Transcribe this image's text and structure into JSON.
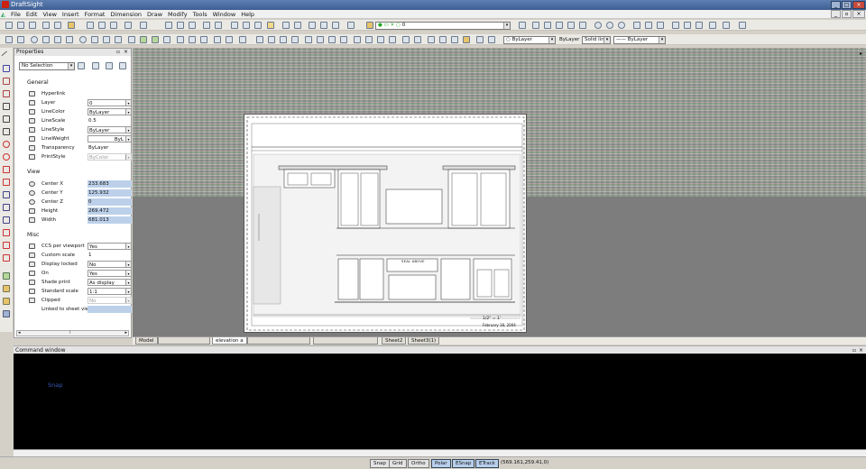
{
  "window": {
    "title": "DraftSight"
  },
  "menu": [
    "File",
    "Edit",
    "View",
    "Insert",
    "Format",
    "Dimension",
    "Draw",
    "Modify",
    "Tools",
    "Window",
    "Help"
  ],
  "toolbar": {
    "layer_combo": "0",
    "color_combo": "ByLayer",
    "linestyle_label": "ByLayer",
    "linestyle_combo": "Solid line",
    "lineweight_combo": "ByLayer"
  },
  "properties": {
    "title": "Properties",
    "selection": "No Selection",
    "general_title": "General",
    "general": [
      {
        "label": "Hyperlink",
        "value": "",
        "style": "plain"
      },
      {
        "label": "Layer",
        "value": "0",
        "style": "box"
      },
      {
        "label": "LineColor",
        "value": "ByLayer",
        "style": "box"
      },
      {
        "label": "LineScale",
        "value": "0.5",
        "style": "plain"
      },
      {
        "label": "LineStyle",
        "value": "ByLayer",
        "style": "box"
      },
      {
        "label": "LineWeight",
        "value": "ByL",
        "style": "box"
      },
      {
        "label": "Transparency",
        "value": "ByLayer",
        "style": "plain"
      },
      {
        "label": "PrintStyle",
        "value": "ByColor",
        "style": "gray"
      }
    ],
    "view_title": "View",
    "view": [
      {
        "label": "Center X",
        "value": "233.683",
        "style": "blue"
      },
      {
        "label": "Center Y",
        "value": "125.932",
        "style": "blue"
      },
      {
        "label": "Center Z",
        "value": "0",
        "style": "blue"
      },
      {
        "label": "Height",
        "value": "269.472",
        "style": "blue"
      },
      {
        "label": "Width",
        "value": "681.013",
        "style": "blue"
      }
    ],
    "misc_title": "Misc",
    "misc": [
      {
        "label": "CCS per viewport",
        "value": "Yes",
        "style": "box"
      },
      {
        "label": "Custom scale",
        "value": "1",
        "style": "plain"
      },
      {
        "label": "Display locked",
        "value": "No",
        "style": "box"
      },
      {
        "label": "On",
        "value": "Yes",
        "style": "box"
      },
      {
        "label": "Shade print",
        "value": "As display",
        "style": "box"
      },
      {
        "label": "Standard scale",
        "value": "1:1",
        "style": "box"
      },
      {
        "label": "Clipped",
        "value": "No",
        "style": "gray"
      },
      {
        "label": "Linked to sheet view",
        "value": "",
        "style": "blue"
      }
    ]
  },
  "drawing": {
    "label": "SEAL ABOVE",
    "scale": "1/2\" = 1'",
    "date": "February 18, 2004"
  },
  "tabs": [
    "Model",
    "",
    "elevation a",
    "",
    "",
    "Sheet2",
    "Sheet3(1)"
  ],
  "command": {
    "title": "Command window",
    "text": "Snap"
  },
  "status": {
    "buttons": [
      {
        "label": "Snap",
        "on": false
      },
      {
        "label": "Grid",
        "on": false
      },
      {
        "label": "Ortho",
        "on": false
      },
      {
        "label": "Polar",
        "on": true
      },
      {
        "label": "ESnap",
        "on": true
      },
      {
        "label": "ETrack",
        "on": true
      }
    ],
    "coords": "(569.161,259.41,0)"
  }
}
